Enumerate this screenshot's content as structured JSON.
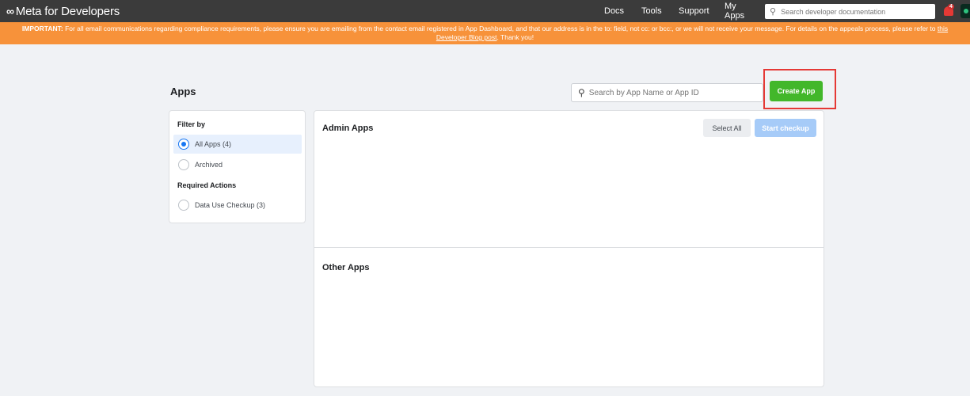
{
  "nav": {
    "logo_text": "Meta for Developers",
    "logo_icon": "meta-infinity-icon",
    "links": [
      "Docs",
      "Tools",
      "Support",
      "My Apps"
    ],
    "search_placeholder": "Search developer documentation",
    "notification_count": "4"
  },
  "banner": {
    "prefix": "IMPORTANT:",
    "text": "For all email communications regarding compliance requirements, please ensure you are emailing from the contact email registered in App Dashboard, and that our address is in the to: field, not cc: or bcc:, or we will not receive your message. For details on the appeals process, please refer to",
    "link": "this Developer Blog post",
    "suffix": ". Thank you!"
  },
  "page": {
    "title": "Apps",
    "search_placeholder": "Search by App Name or App ID",
    "create_button": "Create App"
  },
  "filter": {
    "title": "Filter by",
    "options": [
      {
        "label": "All Apps (4)",
        "selected": true
      },
      {
        "label": "Archived",
        "selected": false
      }
    ],
    "required_title": "Required Actions",
    "required_options": [
      {
        "label": "Data Use Checkup (3)",
        "selected": false
      }
    ]
  },
  "main": {
    "admin_title": "Admin Apps",
    "select_all": "Select All",
    "start_checkup": "Start checkup",
    "other_title": "Other Apps"
  },
  "colors": {
    "nav_bg": "#3b3b3b",
    "banner_bg": "#f7923a",
    "create_green": "#42b72a",
    "highlight_red": "#e53935",
    "accent_blue": "#1877f2"
  }
}
